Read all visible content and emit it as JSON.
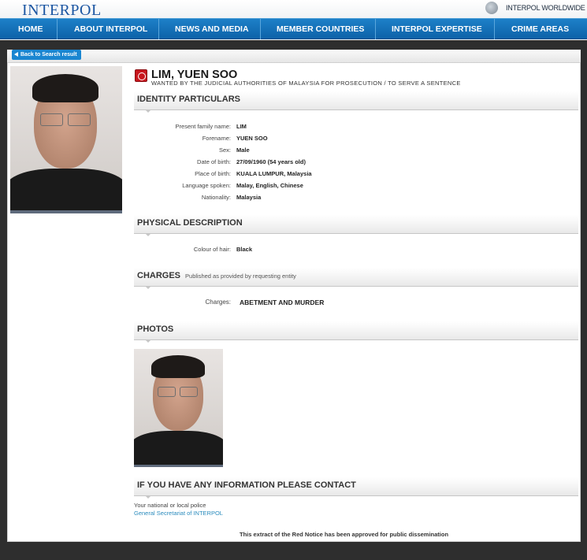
{
  "header": {
    "logo": "INTERPOL",
    "worldwide": "INTERPOL WORLDWIDE"
  },
  "nav": {
    "items": [
      "HOME",
      "ABOUT INTERPOL",
      "NEWS AND MEDIA",
      "MEMBER COUNTRIES",
      "INTERPOL EXPERTISE",
      "CRIME AREAS"
    ]
  },
  "back_button": "Back to Search result",
  "notice": {
    "name": "LIM, YUEN SOO",
    "wanted_by": "WANTED BY THE JUDICIAL AUTHORITIES OF MALAYSIA FOR PROSECUTION / TO SERVE A SENTENCE"
  },
  "identity": {
    "title": "IDENTITY PARTICULARS",
    "rows": [
      {
        "label": "Present family name:",
        "value": "LIM"
      },
      {
        "label": "Forename:",
        "value": "YUEN SOO"
      },
      {
        "label": "Sex:",
        "value": "Male"
      },
      {
        "label": "Date of birth:",
        "value": "27/09/1960 (54 years old)"
      },
      {
        "label": "Place of birth:",
        "value": "KUALA LUMPUR, Malaysia"
      },
      {
        "label": "Language spoken:",
        "value": "Malay, English, Chinese"
      },
      {
        "label": "Nationality:",
        "value": "Malaysia"
      }
    ]
  },
  "physical": {
    "title": "PHYSICAL DESCRIPTION",
    "rows": [
      {
        "label": "Colour of hair:",
        "value": "Black"
      }
    ]
  },
  "charges": {
    "title": "CHARGES",
    "subtitle": "Published as provided by requesting entity",
    "label": "Charges:",
    "value": "ABETMENT AND MURDER"
  },
  "photos": {
    "title": "PHOTOS"
  },
  "contact": {
    "title": "IF YOU HAVE ANY INFORMATION PLEASE CONTACT",
    "line1": "Your national or local police",
    "link": "General Secretariat of INTERPOL"
  },
  "footer_note": "This extract of the Red Notice has been approved for public dissemination",
  "colors": {
    "brand_blue": "#1c56a2",
    "nav_blue": "#0d62a8",
    "link": "#2a8bbd",
    "red_notice": "#c8161d"
  }
}
